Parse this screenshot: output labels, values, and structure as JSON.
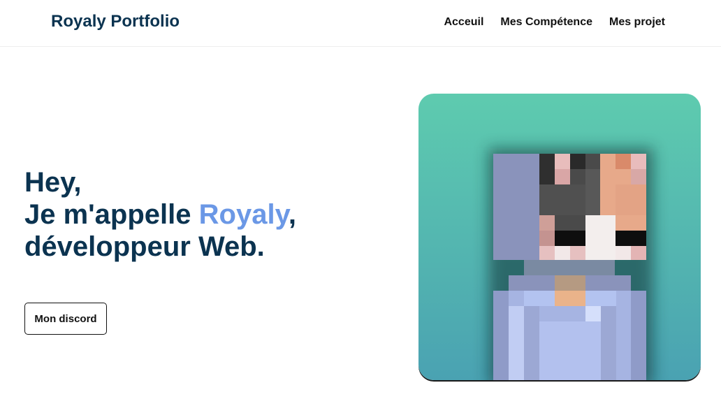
{
  "header": {
    "brand": "Royaly Portfolio",
    "nav": [
      "Acceuil",
      "Mes Compétence",
      "Mes projet"
    ]
  },
  "hero": {
    "line1": "Hey,",
    "line2_prefix": "Je m'appelle ",
    "line2_name": "Royaly",
    "line2_suffix": ",",
    "line3": "développeur Web."
  },
  "cta": {
    "label": "Mon discord"
  },
  "colors": {
    "brand": "#0b3350",
    "accent": "#6b98e6",
    "card_top": "#5ecbaf",
    "card_bottom": "#4aa2b2"
  }
}
